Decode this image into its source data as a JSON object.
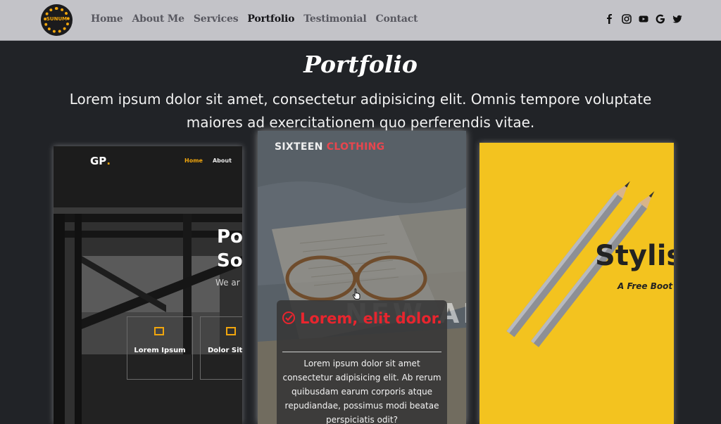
{
  "nav": {
    "logo_text": "SUNUM",
    "items": [
      {
        "label": "Home",
        "active": false
      },
      {
        "label": "About Me",
        "active": false
      },
      {
        "label": "Services",
        "active": false
      },
      {
        "label": "Portfolio",
        "active": true
      },
      {
        "label": "Testimonial",
        "active": false
      },
      {
        "label": "Contact",
        "active": false
      }
    ],
    "social": [
      "facebook-icon",
      "instagram-icon",
      "youtube-icon",
      "google-icon",
      "twitter-icon"
    ]
  },
  "section": {
    "title": "Portfolio",
    "lead": "Lorem ipsum dolor sit amet, consectetur adipisicing elit. Omnis tempore voluptate maiores ad exercitationem quo perferendis vitae."
  },
  "card1": {
    "brand": "GP",
    "brand_dot": ".",
    "nav_home": "Home",
    "nav_about": "About",
    "heading_line1": "Po",
    "heading_line2": "Solu",
    "subtext": "We ar",
    "box1_label": "Lorem Ipsum",
    "box2_label": "Dolor Sit"
  },
  "card2": {
    "brand_white": "SIXTEEN",
    "brand_red": "CLOTHING",
    "bg_text": "NEW AR",
    "overlay_title": "Lorem, elit dolor.",
    "overlay_text": "Lorem ipsum dolor sit amet consectetur adipisicing elit. Ab rerum quibusdam earum corporis atque repudiandae, possimus modi beatae perspiciatis odit?"
  },
  "card3": {
    "heading": "Stylis",
    "subtext": "A Free Boot"
  },
  "colors": {
    "accent": "#f1a60d",
    "red": "#e8252e",
    "background": "#212327",
    "navbar": "#c3c3c8"
  }
}
